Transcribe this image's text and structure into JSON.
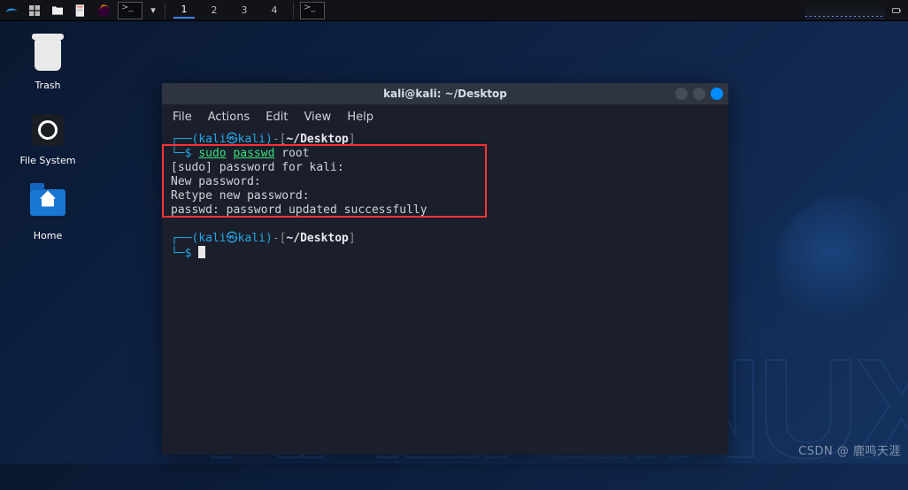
{
  "taskbar": {
    "workspaces": [
      "1",
      "2",
      "3",
      "4"
    ],
    "active_workspace": "1"
  },
  "desktop": {
    "icons": [
      {
        "label": "Trash",
        "kind": "trash"
      },
      {
        "label": "File System",
        "kind": "filesystem"
      },
      {
        "label": "Home",
        "kind": "home"
      }
    ],
    "bg_text": "KALI LINUX"
  },
  "terminal": {
    "title": "kali@kali: ~/Desktop",
    "menu": [
      "File",
      "Actions",
      "Edit",
      "View",
      "Help"
    ],
    "prompt": {
      "user": "kali",
      "sep": "㉿",
      "host": "kali",
      "path": "~/Desktop",
      "dollar": "$"
    },
    "command": {
      "sudo": "sudo",
      "cmd": "passwd",
      "arg": "root"
    },
    "output": [
      "[sudo] password for kali:",
      "New password:",
      "Retype new password:",
      "passwd: password updated successfully"
    ]
  },
  "watermark": "CSDN @ 鹿鸣天涯"
}
